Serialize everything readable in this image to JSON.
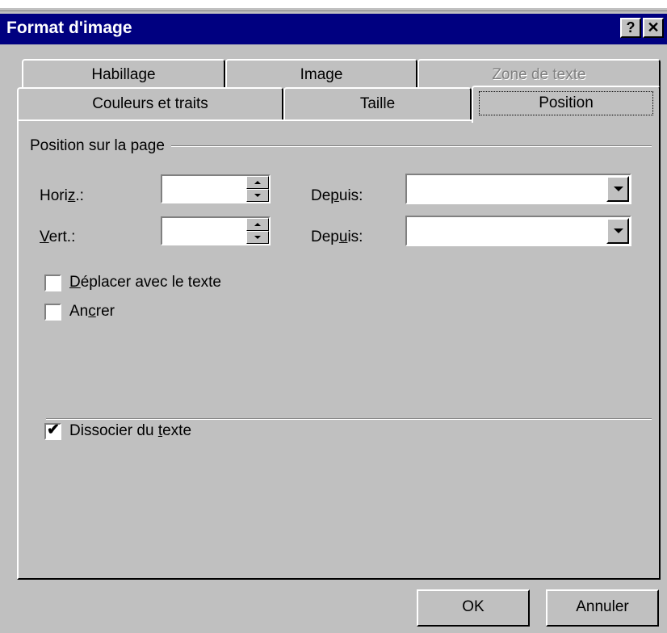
{
  "window": {
    "title": "Format d'image",
    "help_btn": "?",
    "close_btn": "✕"
  },
  "tabs_back": [
    {
      "label": "Habillage",
      "disabled": false
    },
    {
      "label": "Image",
      "disabled": false
    },
    {
      "label": "Zone de texte",
      "disabled": true
    }
  ],
  "tabs_front": [
    {
      "label": "Couleurs et traits"
    },
    {
      "label": "Taille"
    },
    {
      "label": "Position",
      "active": true
    }
  ],
  "group": {
    "title": "Position sur la page"
  },
  "fields": {
    "horiz_label_pre": "Hori",
    "horiz_label_u": "z",
    "horiz_label_post": ".:",
    "horiz_value": "",
    "vert_label_u": "V",
    "vert_label_post": "ert.:",
    "vert_value": "",
    "depuis1_pre": "De",
    "depuis1_u": "p",
    "depuis1_post": "uis:",
    "depuis1_value": "",
    "depuis2_pre": "Dep",
    "depuis2_u": "u",
    "depuis2_post": "is:",
    "depuis2_value": ""
  },
  "checkboxes": {
    "deplacer": {
      "u": "D",
      "rest": "éplacer avec le texte",
      "checked": false
    },
    "ancrer": {
      "pre": "An",
      "u": "c",
      "post": "rer",
      "checked": false
    },
    "dissocier": {
      "pre": "Dissocier du ",
      "u": "t",
      "post": "exte",
      "checked": true,
      "mark": "✔"
    }
  },
  "buttons": {
    "ok": "OK",
    "cancel": "Annuler"
  }
}
